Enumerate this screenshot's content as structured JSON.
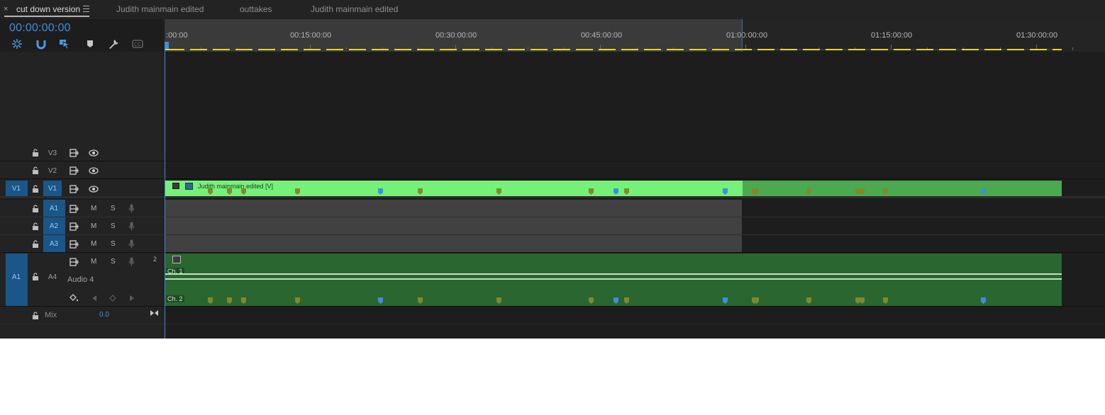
{
  "tabs": [
    {
      "label": "cut down version",
      "active": true
    },
    {
      "label": "Judith mainmain edited",
      "active": false
    },
    {
      "label": "outtakes",
      "active": false
    },
    {
      "label": "Judith mainmain edited",
      "active": false
    }
  ],
  "tab_close_glyph": "×",
  "timecode": "00:00:00:00",
  "toolbar_icons": [
    "nest-icon",
    "snap-magnet-icon",
    "linked-selection-icon",
    "add-marker-icon",
    "wrench-settings-icon",
    "captions-icon"
  ],
  "ruler": {
    "labels": [
      ":00:00",
      "00:15:00:00",
      "00:30:00:00",
      "00:45:00:00",
      "01:00:00:00",
      "01:15:00:00",
      "01:30:00:00"
    ]
  },
  "tracks": {
    "v3": {
      "label": "V3"
    },
    "v2": {
      "label": "V2"
    },
    "v1": {
      "label": "V1",
      "source_patch": "V1"
    },
    "a1": {
      "label": "A1",
      "m": "M",
      "s": "S"
    },
    "a2": {
      "label": "A2",
      "m": "M",
      "s": "S"
    },
    "a3": {
      "label": "A3",
      "m": "M",
      "s": "S"
    },
    "a4": {
      "label": "A4",
      "m": "M",
      "s": "S",
      "source_patch": "A1",
      "name": "Audio 4",
      "channels": "2"
    },
    "mix": {
      "label": "Mix",
      "value": "0.0"
    }
  },
  "clips": {
    "video": {
      "name": "Judith mainmain edited [V]"
    },
    "audio": {
      "ch1": "Ch. 1",
      "ch2": "Ch. 2"
    }
  },
  "colors": {
    "accent": "#3c8fde",
    "video_clip": "#77f07a",
    "video_clip_outside": "#4ca94f",
    "audio_clip": "#2a6630",
    "marker_olive": "#7f8a2c",
    "marker_blue": "#3c8fde",
    "work_area": "#e8d42a"
  }
}
